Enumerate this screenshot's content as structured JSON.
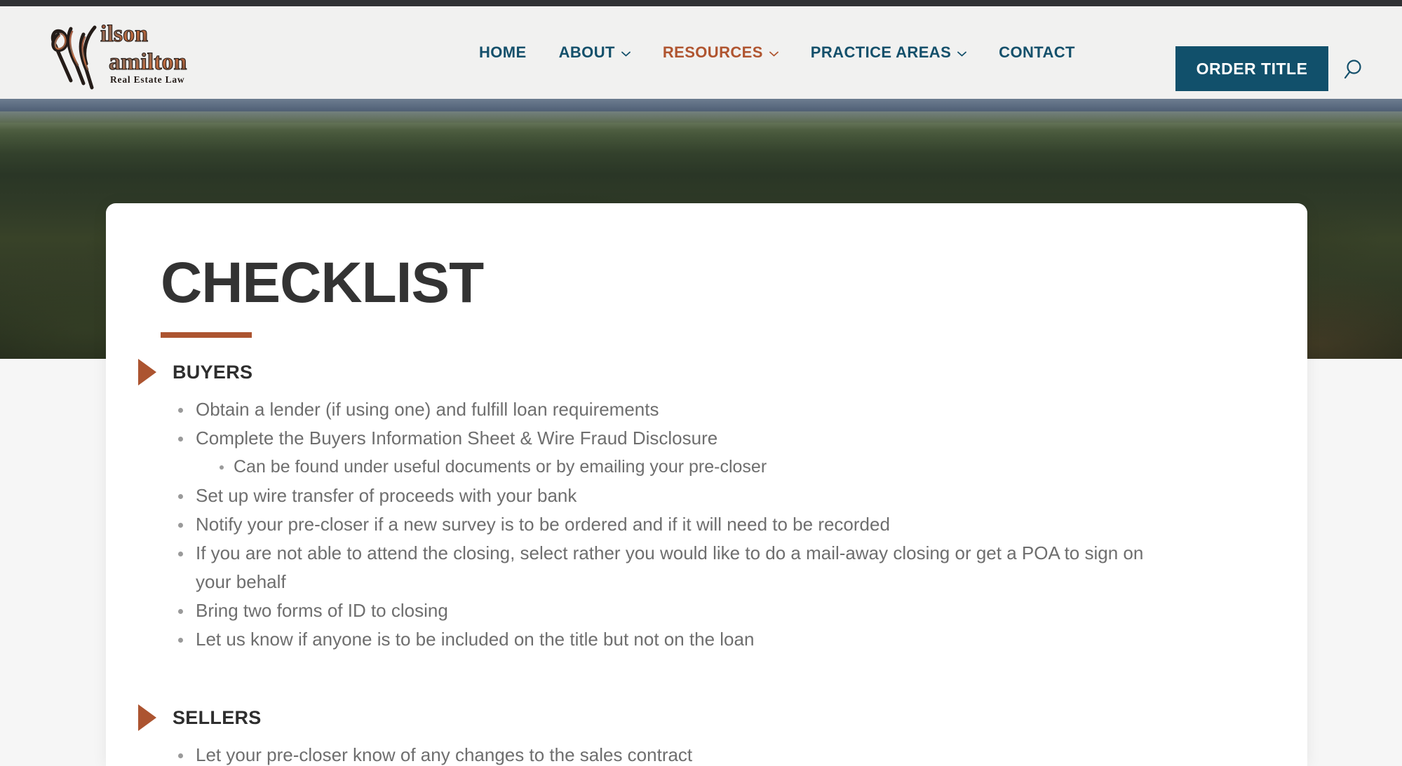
{
  "chrome": {
    "strip_color": "#303234"
  },
  "brand": {
    "logo_line1": "Wilson",
    "logo_line2": "Hamilton",
    "logo_tagline": "Real Estate Law",
    "logo_monogram": "WH",
    "logo_color": "#b05530"
  },
  "header": {
    "background": "#f1f1f0",
    "nav_color": "#14506b",
    "nav_active_color": "#b05530",
    "items": [
      {
        "label": "HOME",
        "has_dropdown": false,
        "active": false
      },
      {
        "label": "ABOUT",
        "has_dropdown": true,
        "active": false
      },
      {
        "label": "RESOURCES",
        "has_dropdown": true,
        "active": true
      },
      {
        "label": "PRACTICE AREAS",
        "has_dropdown": true,
        "active": false
      },
      {
        "label": "CONTACT",
        "has_dropdown": false,
        "active": false
      }
    ],
    "order_button": {
      "label": "ORDER TITLE",
      "background": "#11506b",
      "text_color": "#ffffff"
    },
    "search_icon": "search-icon"
  },
  "hero": {
    "image_alt": "forested mountain ridge landscape"
  },
  "main": {
    "title": "CHECKLIST",
    "title_color": "#333333",
    "accent_color": "#ac5430",
    "sections": [
      {
        "heading": "BUYERS",
        "items": [
          {
            "text": "Obtain a lender (if using one) and fulfill loan requirements",
            "sub": []
          },
          {
            "text": "Complete the Buyers Information Sheet & Wire Fraud Disclosure",
            "sub": [
              "Can be found under useful documents or by emailing your pre-closer"
            ]
          },
          {
            "text": "Set up wire transfer of proceeds with your bank",
            "sub": []
          },
          {
            "text": "Notify your pre-closer if a new survey is to be ordered and if it will need to be recorded",
            "sub": []
          },
          {
            "text": "If you are not able to attend the closing, select rather you would like to do a mail-away closing or get a POA to sign on your behalf",
            "sub": []
          },
          {
            "text": "Bring two forms of ID to closing",
            "sub": []
          },
          {
            "text": "Let us know if anyone is to be included on the title but not on the loan",
            "sub": []
          }
        ]
      },
      {
        "heading": "SELLERS",
        "items": [
          {
            "text": "Let your pre-closer know of any changes to the sales contract",
            "sub": []
          }
        ]
      }
    ]
  }
}
